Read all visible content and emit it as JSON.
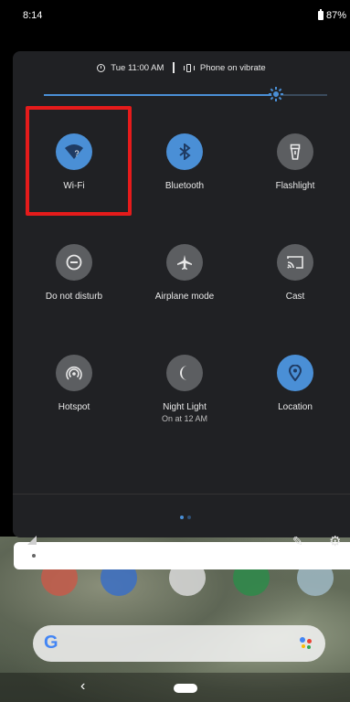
{
  "status_bar": {
    "time": "8:14",
    "battery": "87%"
  },
  "header": {
    "alarm": "Tue 11:00 AM",
    "ringer": "Phone on vibrate"
  },
  "brightness": {
    "level": 0.82
  },
  "tiles": [
    {
      "label": "Wi-Fi",
      "icon": "wifi-question-icon",
      "glyph": "?",
      "active": true
    },
    {
      "label": "Bluetooth",
      "icon": "bluetooth-icon",
      "glyph": "✱",
      "active": true
    },
    {
      "label": "Flashlight",
      "icon": "flashlight-icon",
      "glyph": "▯",
      "active": false
    },
    {
      "label": "Do not disturb",
      "icon": "do-not-disturb-icon",
      "glyph": "⊖",
      "active": false
    },
    {
      "label": "Airplane mode",
      "icon": "airplane-icon",
      "glyph": "✈",
      "active": false
    },
    {
      "label": "Cast",
      "icon": "cast-icon",
      "glyph": "▭",
      "active": false
    },
    {
      "label": "Hotspot",
      "icon": "hotspot-icon",
      "glyph": "◉",
      "active": false
    },
    {
      "label": "Night Light",
      "sub": "On at 12 AM",
      "icon": "moon-icon",
      "glyph": "☾",
      "active": false
    },
    {
      "label": "Location",
      "icon": "location-pin-icon",
      "glyph": "●",
      "active": true
    }
  ],
  "search": {
    "logo": "G"
  },
  "colors": {
    "accent": "#4a8fd6",
    "panel": "#202124",
    "highlight": "#e51b1b"
  }
}
